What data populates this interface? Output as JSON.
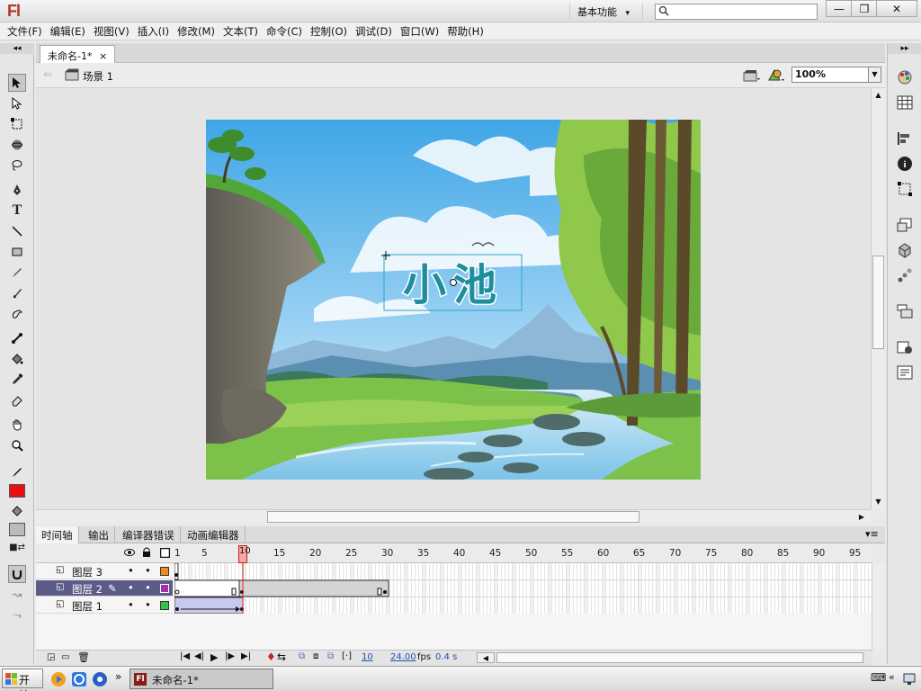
{
  "app": {
    "logo": "Fl",
    "workspace": "基本功能",
    "workspace_arrow": "▾",
    "search_placeholder": ""
  },
  "window_buttons": {
    "minimize": "—",
    "maximize": "❐",
    "close": "✕"
  },
  "menu": [
    "文件(F)",
    "编辑(E)",
    "视图(V)",
    "插入(I)",
    "修改(M)",
    "文本(T)",
    "命令(C)",
    "控制(O)",
    "调试(D)",
    "窗口(W)",
    "帮助(H)"
  ],
  "document": {
    "tab_label": "未命名-1*",
    "tab_close": "×",
    "scene_label": "场景 1",
    "zoom": "100%"
  },
  "stage": {
    "title_text": "小池",
    "title_color": "#1f8e9c",
    "sky_color": "#6fb8ea",
    "grass_color": "#7cc24a",
    "water_color": "#a8d8f0"
  },
  "timeline": {
    "tabs": [
      "时间轴",
      "输出",
      "编译器错误",
      "动画编辑器"
    ],
    "active_tab": 0,
    "ruler": [
      1,
      5,
      10,
      15,
      20,
      25,
      30,
      35,
      40,
      45,
      50,
      55,
      60,
      65,
      70,
      75,
      80,
      85,
      90,
      95
    ],
    "current_frame": 10,
    "layers": [
      {
        "name": "图层 3",
        "selected": false,
        "color": "#f08a1a"
      },
      {
        "name": "图层 2",
        "selected": true,
        "color": "#a030b0"
      },
      {
        "name": "图层 1",
        "selected": false,
        "color": "#36c24a"
      }
    ],
    "footer": {
      "frame": "10",
      "fps": "24.00",
      "fps_unit": "fps",
      "time": "0.4 s"
    }
  },
  "taskbar": {
    "start_label": "开始",
    "task_label": "未命名-1*",
    "more": "»"
  },
  "colors": {
    "stroke": "#000000",
    "fill": "#e81010",
    "accent": "#5b5b88"
  }
}
